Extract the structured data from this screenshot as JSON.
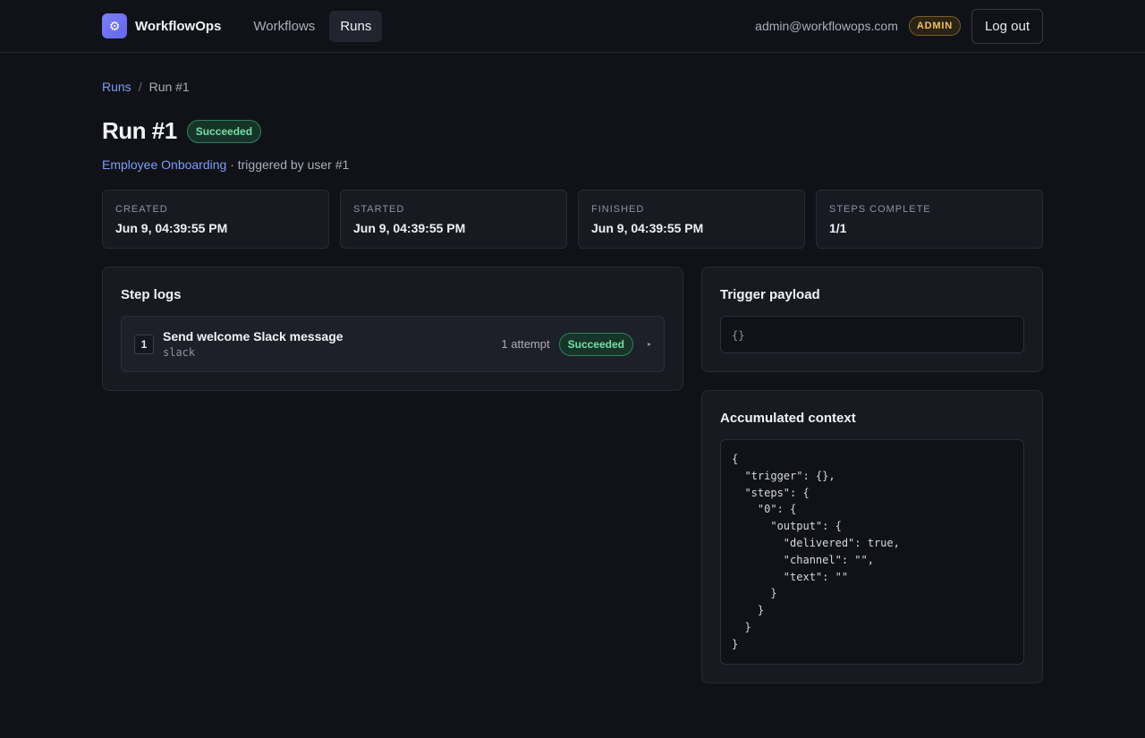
{
  "header": {
    "brand": "WorkflowOps",
    "logo_icon": "gear-icon",
    "nav": [
      {
        "label": "Workflows",
        "active": false
      },
      {
        "label": "Runs",
        "active": true
      }
    ],
    "user_email": "admin@workflowops.com",
    "role_badge": "ADMIN",
    "logout_label": "Log out"
  },
  "breadcrumb": {
    "parent": "Runs",
    "separator": "/",
    "current": "Run #1"
  },
  "run": {
    "title": "Run #1",
    "status": "Succeeded",
    "workflow_name": "Employee Onboarding",
    "triggered_by": " · triggered by user #1"
  },
  "stats": [
    {
      "label": "CREATED",
      "value": "Jun 9, 04:39:55 PM"
    },
    {
      "label": "STARTED",
      "value": "Jun 9, 04:39:55 PM"
    },
    {
      "label": "FINISHED",
      "value": "Jun 9, 04:39:55 PM"
    },
    {
      "label": "STEPS COMPLETE",
      "value": "1/1"
    }
  ],
  "step_logs": {
    "title": "Step logs",
    "steps": [
      {
        "index": "1",
        "name": "Send welcome Slack message",
        "type": "slack",
        "attempts": "1 attempt",
        "status": "Succeeded"
      }
    ]
  },
  "trigger_payload": {
    "title": "Trigger payload",
    "content": "{}"
  },
  "context": {
    "title": "Accumulated context",
    "content": "{\n  \"trigger\": {},\n  \"steps\": {\n    \"0\": {\n      \"output\": {\n        \"delivered\": true,\n        \"channel\": \"\",\n        \"text\": \"\"\n      }\n    }\n  }\n}"
  },
  "colors": {
    "accent": "#7d9cf6",
    "success": "#74dfa8",
    "admin": "#f1c25a",
    "background": "#111218"
  }
}
